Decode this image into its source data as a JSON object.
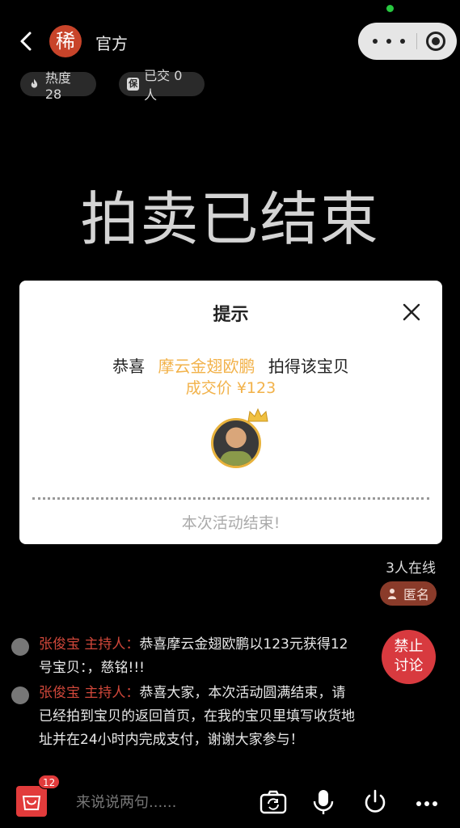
{
  "header": {
    "logo_char": "稀",
    "title": "官方",
    "chips": {
      "heat_label": "热度 28",
      "deal_label": "已交 0 人",
      "deal_icon_char": "保"
    }
  },
  "main": {
    "status_title": "拍卖已结束"
  },
  "dialog": {
    "title": "提示",
    "congrats_prefix": "恭喜",
    "winner_name": "摩云金翅欧鹏",
    "congrats_suffix": "拍得该宝贝",
    "price_label": "成交价 ¥123",
    "ended_text": "本次活动结束!"
  },
  "side": {
    "online_count": "3人在线",
    "anon_label": "匿名",
    "ban_label_line1": "禁止",
    "ban_label_line2": "讨论"
  },
  "messages": [
    {
      "sender": "张俊宝 主持人：",
      "content": "恭喜摩云金翅欧鹏以123元获得12号宝贝：，慈铭!!!"
    },
    {
      "sender": "张俊宝 主持人：",
      "content": "恭喜大家，本次活动圆满结束，请已经拍到宝贝的返回首页，在我的宝贝里填写收货地址并在24小时内完成支付，谢谢大家参与！"
    }
  ],
  "bottom": {
    "cart_count": "12",
    "input_placeholder": "来说说两句......"
  },
  "colors": {
    "accent_red": "#d83a3f",
    "winner_gold": "#f2b24a",
    "sender_red": "#d0473a"
  }
}
